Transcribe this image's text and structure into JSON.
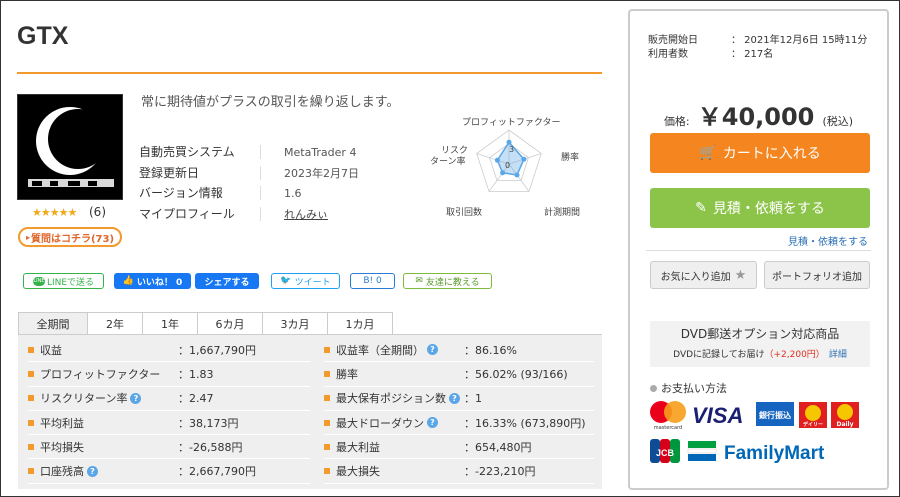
{
  "product": {
    "title": "GTX",
    "tagline": "常に期待値がプラスの取引を繰り返します。",
    "rating_stars": "★★★★★",
    "rating_count": "(6)",
    "question_button": "質問はコチラ(73)"
  },
  "info": [
    {
      "key": "自動売買システム",
      "value": "MetaTrader 4"
    },
    {
      "key": "登録更新日",
      "value": "2023年2月7日"
    },
    {
      "key": "バージョン情報",
      "value": "1.6"
    },
    {
      "key": "マイプロフィール",
      "value": "れんみぃ"
    }
  ],
  "radar": {
    "labels": {
      "top": "プロフィットファクター",
      "right": "勝率",
      "bottom_right": "計測期間",
      "bottom_left": "取引回数",
      "left_1": "リスク",
      "left_2": "ターン率"
    },
    "scale_labels": [
      "3",
      "0"
    ],
    "values": {
      "profit_factor": 3.2,
      "win_rate": 2.3,
      "period": 2.0,
      "trades": 1.6,
      "risk_return": 1.8
    },
    "max": 5
  },
  "social": {
    "line": "LINEで送る",
    "line_badge": "LINE",
    "like": "いいね！ 0",
    "share": "シェアする",
    "tweet": "ツイート",
    "hatena": "B! 0",
    "mail": "友達に教える"
  },
  "tabs": [
    "全期間",
    "2年",
    "1年",
    "6カ月",
    "3カ月",
    "1カ月"
  ],
  "stats_left": [
    {
      "label": "収益",
      "value": "：1,667,790円",
      "help": false
    },
    {
      "label": "プロフィットファクター",
      "value": "：1.83",
      "help": false
    },
    {
      "label": "リスクリターン率",
      "value": "：2.47",
      "help": true
    },
    {
      "label": "平均利益",
      "value": "：38,173円",
      "help": false
    },
    {
      "label": "平均損失",
      "value": "：-26,588円",
      "help": false
    },
    {
      "label": "口座残高",
      "value": "：2,667,790円",
      "help": true
    }
  ],
  "stats_right": [
    {
      "label": "収益率（全期間）",
      "value": "：86.16%",
      "help": true
    },
    {
      "label": "勝率",
      "value": "：56.02% (93/166)",
      "help": false
    },
    {
      "label": "最大保有ポジション数",
      "value": "：1",
      "help": true
    },
    {
      "label": "最大ドローダウン",
      "value": "：16.33% (673,890円)",
      "help": true
    },
    {
      "label": "最大利益",
      "value": "：654,480円",
      "help": false
    },
    {
      "label": "最大損失",
      "value": "：-223,210円",
      "help": false
    }
  ],
  "help_glyph": "?",
  "side": {
    "sale_start_label": "販売開始日",
    "sale_start_value": "：  2021年12月6日 15時11分",
    "users_label": "利用者数",
    "users_value": "：  217名",
    "price_label": "価格:",
    "price_value": "￥40,000",
    "price_tax": "(税込)",
    "cart_button": "カートに入れる",
    "quote_button": "見積・依頼をする",
    "quote_link": "見積・依頼をする",
    "favorite_button": "お気に入り追加",
    "portfolio_button": "ポートフォリオ追加",
    "dvd_title": "DVD郵送オプション対応商品",
    "dvd_sub_text": "DVDに記録してお届け",
    "dvd_sub_price": "（+2,200円）",
    "dvd_sub_link": "詳細",
    "payment_title": "お支払い方法",
    "payment_logos": {
      "mastercard": "mastercard",
      "visa": "VISA",
      "bank": "銀行振込",
      "daily1": "デイリー",
      "daily2": "Daily",
      "jcb": "JCB",
      "familymart": "FamilyMart"
    }
  },
  "colors": {
    "accent_orange": "#f39a2c",
    "cart_orange": "#f4851f",
    "quote_green": "#8cc44a",
    "link_blue": "#2a6fb6",
    "radar_blue": "#5aa6e6"
  }
}
